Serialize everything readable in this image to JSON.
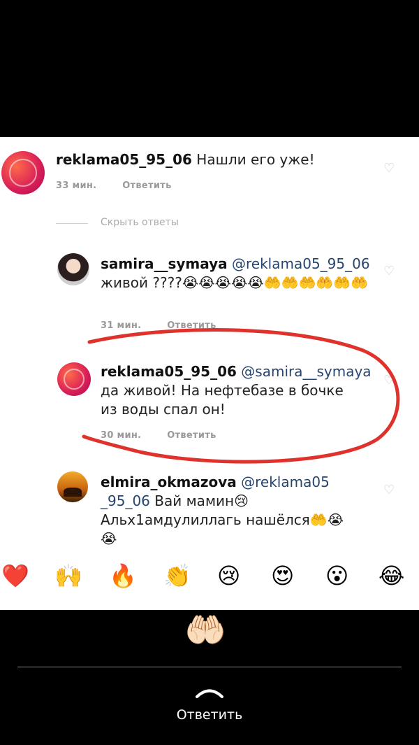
{
  "comments": [
    {
      "user": "reklama05_95_06",
      "text": "Нашли его уже!",
      "time": "33 мин.",
      "reply": "Ответить"
    },
    {
      "user": "samira__symaya",
      "mention": "@reklama05_95_06",
      "text": "живой ????😭😭😭😭😭🤲🤲🤲🤲🤲🤲",
      "time": "31 мин.",
      "reply": "Ответить"
    },
    {
      "user": "reklama05_95_06",
      "mention": "@samira__symaya",
      "text1": "да живой! На нефтебазе в бочке",
      "text2": "из воды спал он!",
      "time": "30 мин.",
      "reply": "Ответить"
    },
    {
      "user": "elmira_okmazova",
      "mention1": "@reklama05",
      "mention2": "_95_06",
      "text1": " Вай мамин😢",
      "text2": "Альх1амдулиллагь нашёлся🤲😭",
      "text3": "😭"
    }
  ],
  "hide_replies": "Скрыть ответы",
  "emoji_bar": [
    "❤️",
    "🙌",
    "🔥",
    "👏",
    "😢",
    "😍",
    "😮",
    "😂"
  ],
  "story_sticker": "🤲🏻",
  "reply_label": "Ответить",
  "colors": {
    "annotation": "#e0322c",
    "mention": "#26456f"
  }
}
